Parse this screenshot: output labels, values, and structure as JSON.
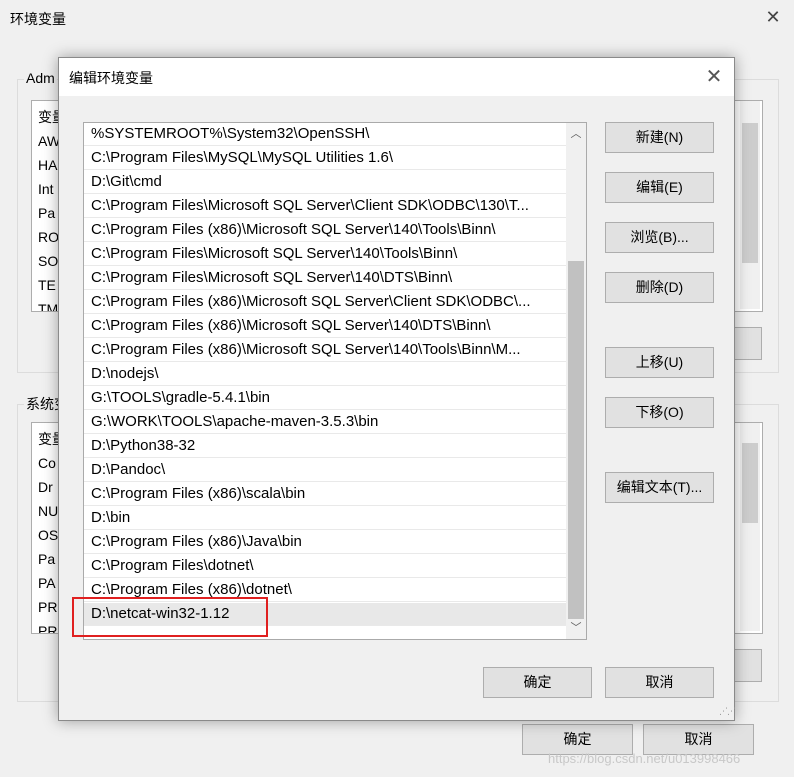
{
  "bg_window": {
    "title": "环境变量",
    "user_group_label": "Adm",
    "user_list_items": [
      "变量",
      "AW",
      "HA",
      "Int",
      "Pa",
      "RO",
      "SO",
      "TE",
      "TM"
    ],
    "system_group_label": "系统变",
    "system_list_items": [
      "变量",
      "Co",
      "Dr",
      "NU",
      "OS",
      "Pa",
      "PA",
      "PR",
      "PR"
    ],
    "ok_label": "确定",
    "cancel_label": "取消",
    "watermark": "https://blog.csdn.net/u013998466"
  },
  "dialog": {
    "title": "编辑环境变量",
    "paths": [
      "%SYSTEMROOT%\\System32\\OpenSSH\\",
      "C:\\Program Files\\MySQL\\MySQL Utilities 1.6\\",
      "D:\\Git\\cmd",
      "C:\\Program Files\\Microsoft SQL Server\\Client SDK\\ODBC\\130\\T...",
      "C:\\Program Files (x86)\\Microsoft SQL Server\\140\\Tools\\Binn\\",
      "C:\\Program Files\\Microsoft SQL Server\\140\\Tools\\Binn\\",
      "C:\\Program Files\\Microsoft SQL Server\\140\\DTS\\Binn\\",
      "C:\\Program Files (x86)\\Microsoft SQL Server\\Client SDK\\ODBC\\...",
      "C:\\Program Files (x86)\\Microsoft SQL Server\\140\\DTS\\Binn\\",
      "C:\\Program Files (x86)\\Microsoft SQL Server\\140\\Tools\\Binn\\M...",
      "D:\\nodejs\\",
      "G:\\TOOLS\\gradle-5.4.1\\bin",
      "G:\\WORK\\TOOLS\\apache-maven-3.5.3\\bin",
      "D:\\Python38-32",
      "D:\\Pandoc\\",
      "C:\\Program Files (x86)\\scala\\bin",
      "D:\\bin",
      "C:\\Program Files (x86)\\Java\\bin",
      "C:\\Program Files\\dotnet\\",
      "C:\\Program Files (x86)\\dotnet\\",
      "D:\\netcat-win32-1.12"
    ],
    "selected_path": "D:\\netcat-win32-1.12",
    "buttons": {
      "new": "新建(N)",
      "edit": "编辑(E)",
      "browse": "浏览(B)...",
      "delete": "删除(D)",
      "move_up": "上移(U)",
      "move_down": "下移(O)",
      "edit_text": "编辑文本(T)...",
      "ok": "确定",
      "cancel": "取消"
    }
  },
  "icons": {
    "close": "close-icon",
    "scroll_up": "chevron-up-icon",
    "scroll_down": "chevron-down-icon",
    "resize_grip": "resize-grip-icon"
  },
  "colors": {
    "highlight_box": "#e02020",
    "primary_border": "#0078d7",
    "selection": "#e8e8e8"
  }
}
